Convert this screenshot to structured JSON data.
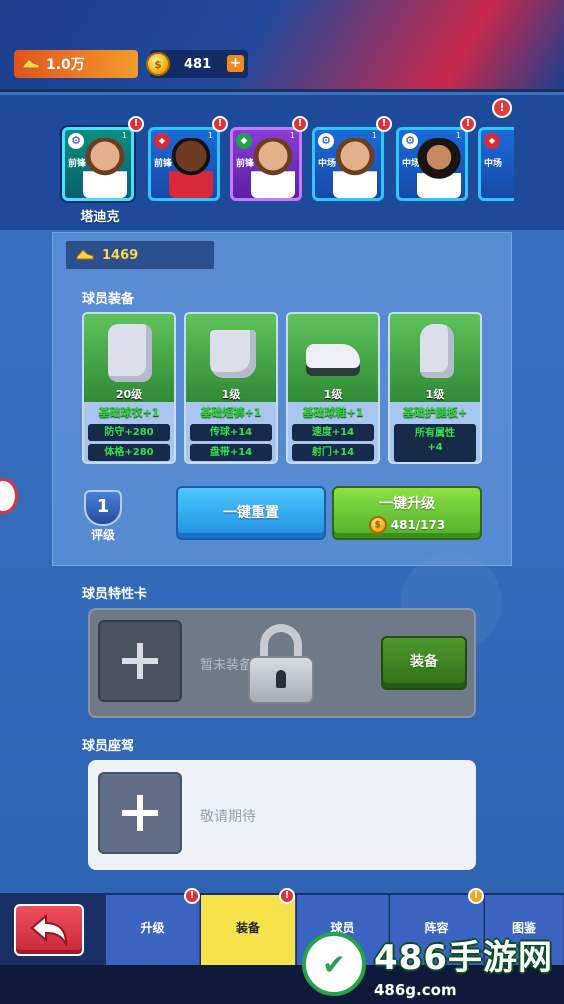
{
  "currencies": {
    "cleats": "1.0万",
    "coins": "481",
    "plus": "+"
  },
  "strip": {
    "info_badge": "!",
    "selected_player_name": "塔迪克",
    "players": [
      {
        "position": "前锋",
        "rank": "1",
        "alert": "!"
      },
      {
        "position": "前锋",
        "rank": "1",
        "alert": "!"
      },
      {
        "position": "前锋",
        "rank": "1",
        "alert": "!"
      },
      {
        "position": "中场",
        "rank": "1",
        "alert": "!"
      },
      {
        "position": "中场",
        "rank": "1",
        "alert": "!"
      },
      {
        "position": "中场",
        "rank": "",
        "alert": ""
      }
    ]
  },
  "equipment": {
    "power": "1469",
    "title": "球员装备",
    "items": [
      {
        "level": "20级",
        "name": "基础球衣+1",
        "stats": [
          "防守+280",
          "体格+280"
        ]
      },
      {
        "level": "1级",
        "name": "基础短裤+1",
        "stats": [
          "传球+14",
          "盘带+14"
        ]
      },
      {
        "level": "1级",
        "name": "基础球鞋+1",
        "stats": [
          "速度+14",
          "射门+14"
        ]
      },
      {
        "level": "1级",
        "name": "基础护腿板+",
        "stats": [
          "所有属性",
          "+4"
        ]
      }
    ],
    "rating_value": "1",
    "rating_label": "评级",
    "reset_label": "一键重置",
    "upgrade_label": "一键升级",
    "upgrade_cost": "481/173"
  },
  "trait": {
    "title": "球员特性卡",
    "empty_text": "暂未装备特性卡",
    "equip_label": "装备"
  },
  "seat": {
    "title": "球员座驾",
    "text": "敬请期待"
  },
  "nav": {
    "tabs": [
      "升级",
      "装备",
      "球员",
      "阵容",
      "图鉴"
    ],
    "badges": [
      "!",
      "!",
      "!"
    ]
  },
  "watermark": {
    "big": "486手游网",
    "small": "486g.com"
  }
}
